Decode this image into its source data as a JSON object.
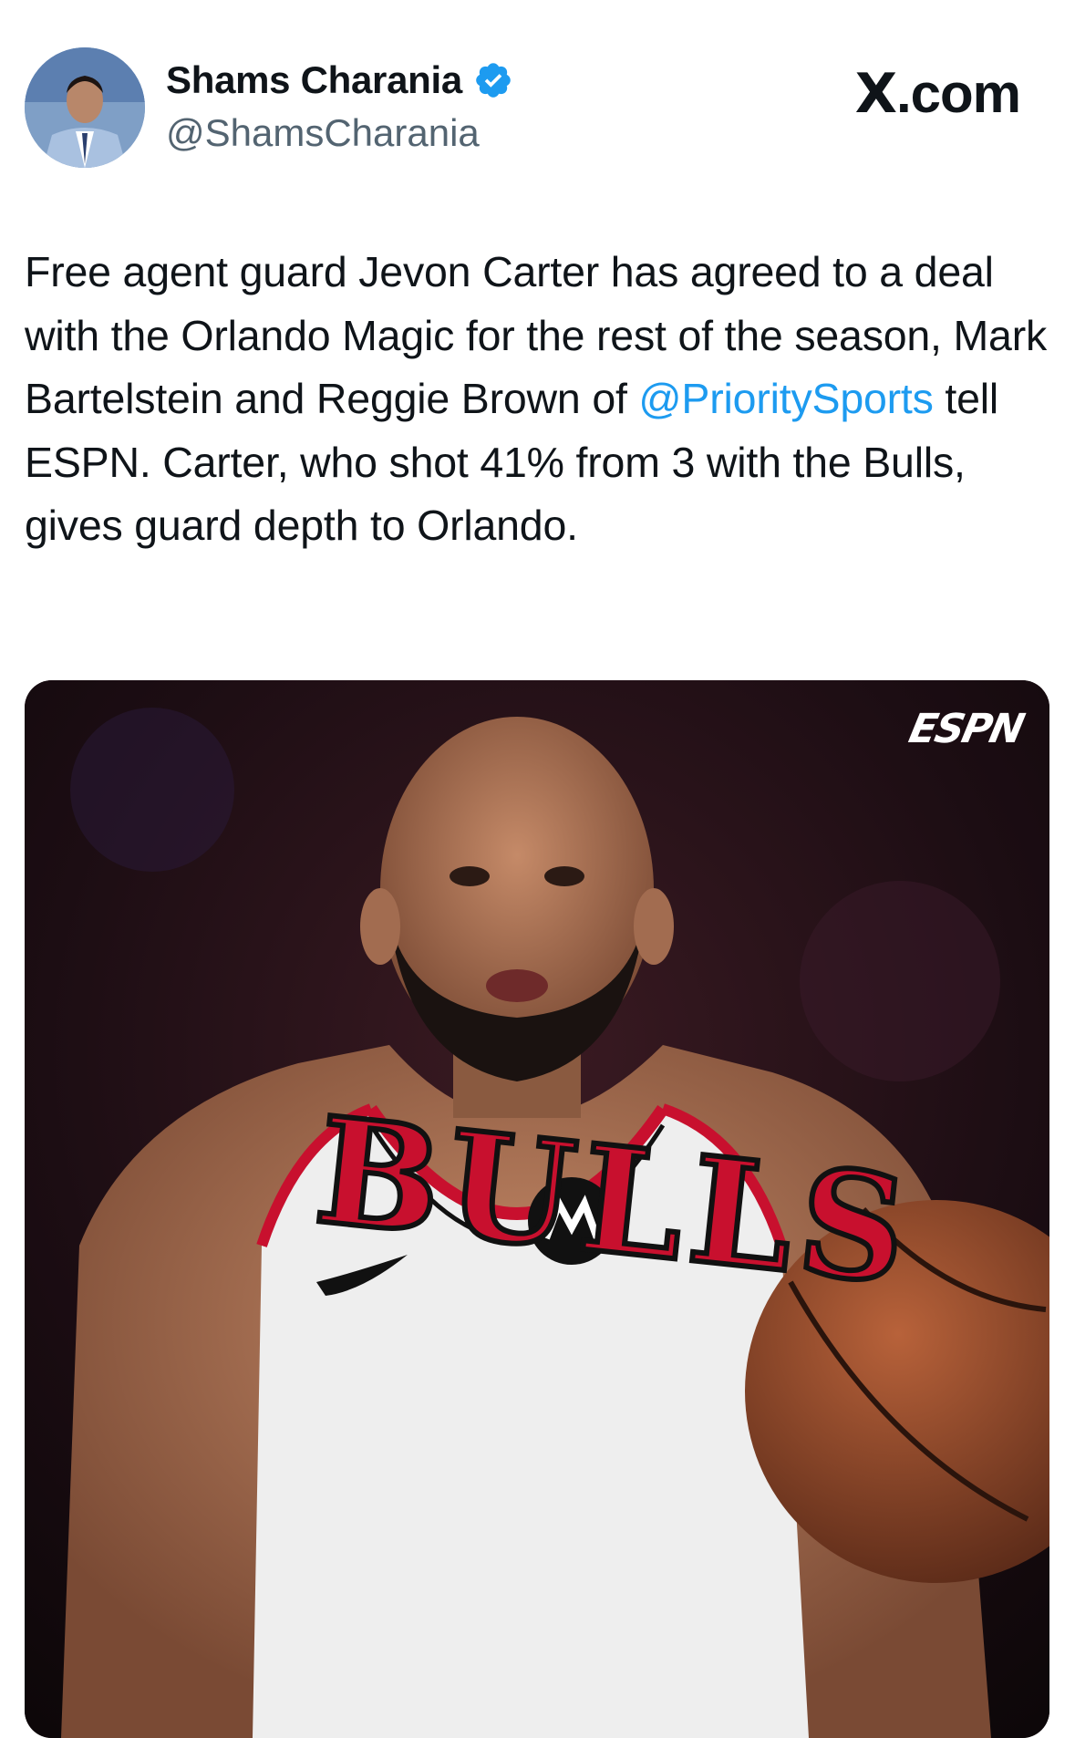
{
  "author": {
    "display_name": "Shams Charania",
    "handle": "@ShamsCharania",
    "verified_icon": "verified-badge-icon",
    "avatar_icon": "avatar-photo"
  },
  "site_label": {
    "x": "X",
    "rest": ".com"
  },
  "tweet": {
    "text_before_mention": "Free agent guard Jevon Carter has agreed to a deal with the Orlando Magic for the rest of the season, Mark Bartelstein and Reggie Brown of ",
    "mention": "@PrioritySports",
    "text_after_mention": " tell ESPN. Carter, who shot 41% from 3 with the Bulls, gives guard depth to Orlando."
  },
  "media": {
    "watermark": "ESPN",
    "jersey_text": "BULLS"
  },
  "colors": {
    "link": "#1d9bf0",
    "verified": "#1d9bf0",
    "secondary_text": "#536471",
    "primary_text": "#0f1419",
    "jersey_red": "#c8102e"
  }
}
